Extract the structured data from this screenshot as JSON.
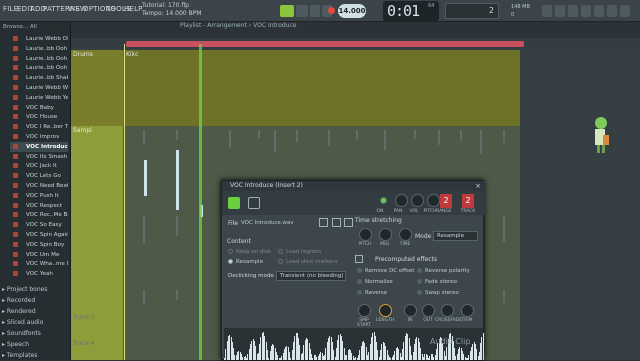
{
  "menu": [
    "FILE",
    "EDIT",
    "ADD",
    "PATTERNS",
    "VIEW",
    "OPTIONS",
    "TOOLS",
    "HELP"
  ],
  "hint": {
    "line1": "Tutorial: 170.flp",
    "line2": "Tempo: 14.000 BPM"
  },
  "transport": {
    "tempo": "14.000",
    "time": "0:01",
    "time_small": "64",
    "pattern_num": "2",
    "cpu": "148 MB",
    "cpu2": "0"
  },
  "browser": {
    "title": "Browse... All",
    "items": [
      "Laurie Webb Oh",
      "Laurie..bb Ooh A",
      "Laurie..bb Ooh B",
      "Laurie..bb Ooh C",
      "Laurie..bb Shake",
      "Laurie Webb Wait",
      "Laurie Webb Yeah",
      "VOC Baby",
      "VOC House",
      "VOC I Re..ber That",
      "VOC Improv",
      "VOC Introduce",
      "VOC Its Smash Hit",
      "VOC Jack It",
      "VOC Lets Go",
      "VOC Need Beat",
      "VOC Push It",
      "VOC Respect",
      "VOC Roc..Me Baby",
      "VOC So Easy",
      "VOC Spin Again",
      "VOC Spin Boy",
      "VOC Um Me",
      "VOC Wha..me Is It",
      "VOC Yeah"
    ],
    "selected_index": 11,
    "folders": [
      "Project bones",
      "Recorded",
      "Rendered",
      "Sliced audio",
      "Soundfonts",
      "Speech",
      "Templates"
    ]
  },
  "playlist": {
    "title": "Playlist - Arrangement › VOC Introduce",
    "tracks": [
      "Drums",
      "Sampl",
      "Track 3",
      "Track 4"
    ],
    "drum_clip": "Kikc"
  },
  "dialog": {
    "title": "VOC Introduce (Insert 2)",
    "knob_labels": [
      "ON",
      "PAN",
      "VOL",
      "PITCH",
      "RANGE",
      "TRACK"
    ],
    "range_value": "2",
    "track_value": "2",
    "file_label": "File",
    "file_name": "VOC Introduce.wav",
    "time_stretch": "Time stretching",
    "ts_knobs": [
      "PITCH",
      "MUL",
      "TIME"
    ],
    "mode_label": "Mode",
    "mode_value": "Resample",
    "content": "Content",
    "radios": [
      "Keep on disk",
      "Resample",
      "Load regions",
      "Load slice markers"
    ],
    "declick_label": "Declicking mode",
    "declick_value": "Transient (no bleeding)",
    "precomp": "Precomputed effects",
    "effects": [
      "Remove DC offset",
      "Normalize",
      "Reverse",
      "Reverse polarity",
      "Fade stereo",
      "Swap stereo"
    ],
    "bottom_knobs": [
      "SMP START",
      "LENGTH",
      "IN",
      "OUT",
      "CROSSFADE",
      "TRIM"
    ],
    "audio_clip": "Audio Clip"
  },
  "colors": {
    "accent": "#6ccf3f",
    "loop": "#c9505e",
    "drum": "#7a7d2a",
    "sampl": "#8d9d3a"
  }
}
